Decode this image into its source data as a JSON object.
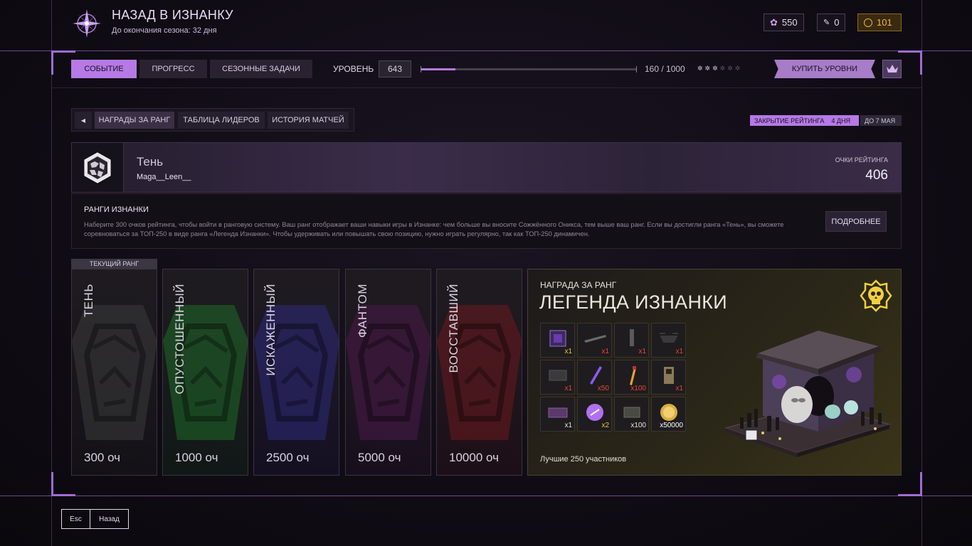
{
  "header": {
    "title": "НАЗАД В ИЗНАНКУ",
    "subtitle": "До окончания сезона: 32 дня",
    "currencies": [
      {
        "icon": "flower-currency-icon",
        "value": "550"
      },
      {
        "icon": "ticket-currency-icon",
        "value": "0"
      },
      {
        "icon": "coin-currency-icon",
        "value": "101",
        "color": "#e8b84a"
      }
    ]
  },
  "tabs": [
    {
      "label": "СОБЫТИЕ",
      "active": true
    },
    {
      "label": "ПРОГРЕСС",
      "active": false
    },
    {
      "label": "СЕЗОННЫЕ ЗАДАЧИ",
      "active": false
    }
  ],
  "level": {
    "label": "УРОВЕНЬ",
    "value": "643",
    "progress_text": "160 / 1000",
    "progress_fraction": 0.16,
    "stars_filled": 3,
    "stars_total": 6
  },
  "buy_levels_label": "КУПИТЬ УРОВНИ",
  "subtabs": [
    {
      "label": "НАГРАДЫ ЗА РАНГ",
      "active": true
    },
    {
      "label": "ТАБЛИЦА ЛИДЕРОВ",
      "active": false
    },
    {
      "label": "ИСТОРИЯ МАТЧЕЙ",
      "active": false
    }
  ],
  "closing": {
    "label": "ЗАКРЫТИЕ РЕЙТИНГА",
    "days": "4 ДНЯ",
    "until": "ДО 7 МАЯ"
  },
  "profile": {
    "rank_name": "Тень",
    "username": "Maga__Leen__",
    "points_label": "ОЧКИ РЕЙТИНГА",
    "points": "406"
  },
  "info": {
    "title": "РАНГИ ИЗНАНКИ",
    "text": "Наберите 300 очков рейтинга, чтобы войти в ранговую систему. Ваш ранг отображает ваши навыки игры в Изнанке: чем больше вы вносите Сожжённого Оникса, тем выше ваш ранг. Если вы достигли ранга «Тень», вы сможете соревноваться за ТОП-250 в виде ранга «Легенда Изнанки». Чтобы удерживать или повышать свою позицию, нужно играть регулярно, так как ТОП-250 динамичен.",
    "more_label": "ПОДРОБНЕЕ"
  },
  "current_rank_tag": "ТЕКУЩИЙ РАНГ",
  "ranks": [
    {
      "name": "ТЕНЬ",
      "points": "300 оч",
      "color": "#3a3a3a"
    },
    {
      "name": "ОПУСТОШЕННЫЙ",
      "points": "1000 оч",
      "color": "#1f6a28"
    },
    {
      "name": "ИСКАЖЕННЫЙ",
      "points": "2500 оч",
      "color": "#2e2a7a"
    },
    {
      "name": "ФАНТОМ",
      "points": "5000 оч",
      "color": "#4a1a48"
    },
    {
      "name": "ВОССТАВШИЙ",
      "points": "10000 оч",
      "color": "#6a1a1e"
    }
  ],
  "reward": {
    "label": "НАГРАДА ЗА РАНГ",
    "title": "ЛЕГЕНДА ИЗНАНКИ",
    "bottom": "Лучшие 250 участников",
    "items": [
      {
        "icon": "purple-cube-icon",
        "count": "x1",
        "count_color": "#e8c23a"
      },
      {
        "icon": "rifle-icon",
        "count": "x1",
        "count_color": "#e8443a"
      },
      {
        "icon": "pistol-icon",
        "count": "x1",
        "count_color": "#e8443a"
      },
      {
        "icon": "drone-icon",
        "count": "x1",
        "count_color": "#e8443a"
      },
      {
        "icon": "crate-icon",
        "count": "x1",
        "count_color": "#e8443a"
      },
      {
        "icon": "glowstick-icon",
        "count": "x50",
        "count_color": "#e8443a"
      },
      {
        "icon": "syringe-icon",
        "count": "x100",
        "count_color": "#e8443a"
      },
      {
        "icon": "device-icon",
        "count": "x1",
        "count_color": "#e8443a"
      },
      {
        "icon": "purple-box-icon",
        "count": "x1",
        "count_color": "#e8e2d8"
      },
      {
        "icon": "purple-token-icon",
        "count": "x2",
        "count_color": "#e8c23a"
      },
      {
        "icon": "ammo-crate-icon",
        "count": "x100",
        "count_color": "#e8e2d8"
      },
      {
        "icon": "gold-coin-icon",
        "count": "x50000",
        "count_color": "#ffffff"
      }
    ]
  },
  "footer": {
    "esc_key": "Esc",
    "back_label": "Назад"
  },
  "colors": {
    "accent": "#b679e6",
    "gold": "#e8b84a"
  }
}
